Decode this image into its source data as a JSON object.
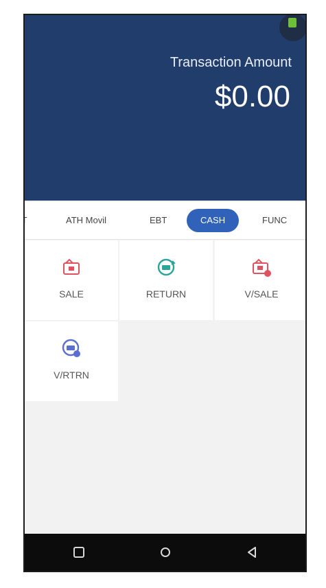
{
  "header": {
    "title": "Transaction Amount",
    "amount": "$0.00"
  },
  "tabs": [
    {
      "label": "IT"
    },
    {
      "label": "ATH Movil"
    },
    {
      "label": "EBT"
    },
    {
      "label": "CASH",
      "active": true
    },
    {
      "label": "FUNC"
    }
  ],
  "actions": [
    {
      "label": "SALE",
      "icon": "wallet-icon"
    },
    {
      "label": "RETURN",
      "icon": "refresh-money-icon"
    },
    {
      "label": "V/SALE",
      "icon": "wallet-void-icon"
    },
    {
      "label": "V/RTRN",
      "icon": "refresh-void-icon"
    }
  ],
  "navbar": {
    "items": [
      "recent-apps-icon",
      "home-icon",
      "back-icon"
    ]
  },
  "colors": {
    "header_bg": "#213d6b",
    "accent": "#2f62b8",
    "sale_icon": "#e0525f",
    "return_icon": "#2aa59a",
    "vrtrn_icon": "#5b6fd0"
  }
}
